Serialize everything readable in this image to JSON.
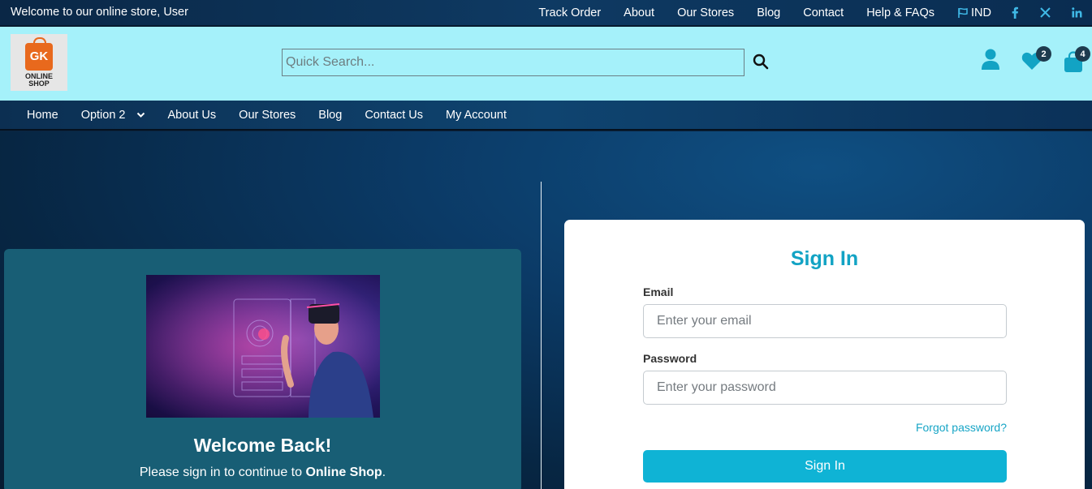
{
  "topbar": {
    "welcome": "Welcome to our online store, User",
    "links": [
      "Track Order",
      "About",
      "Our Stores",
      "Blog",
      "Contact",
      "Help & FAQs"
    ],
    "language": "IND",
    "social_icons": [
      "facebook-icon",
      "x-twitter-icon",
      "linkedin-icon"
    ]
  },
  "header": {
    "logo_mark": "GK",
    "logo_line1": "ONLINE",
    "logo_line2": "SHOP",
    "search_placeholder": "Quick Search...",
    "wishlist_count": "2",
    "cart_count": "4"
  },
  "nav": {
    "items": [
      "Home",
      "Option 2",
      "About Us",
      "Our Stores",
      "Blog",
      "Contact Us",
      "My Account"
    ]
  },
  "welcome_card": {
    "title": "Welcome Back!",
    "subtitle_prefix": "Please sign in to continue to ",
    "subtitle_brand": "Online Shop",
    "subtitle_suffix": "."
  },
  "signin": {
    "title": "Sign In",
    "email_label": "Email",
    "email_placeholder": "Enter your email",
    "password_label": "Password",
    "password_placeholder": "Enter your password",
    "forgot": "Forgot password?",
    "submit": "Sign In"
  },
  "colors": {
    "accent": "#0fb3d5",
    "header_bg": "#a5f1fa",
    "card_bg": "#185e75",
    "logo_orange": "#e8691d"
  }
}
